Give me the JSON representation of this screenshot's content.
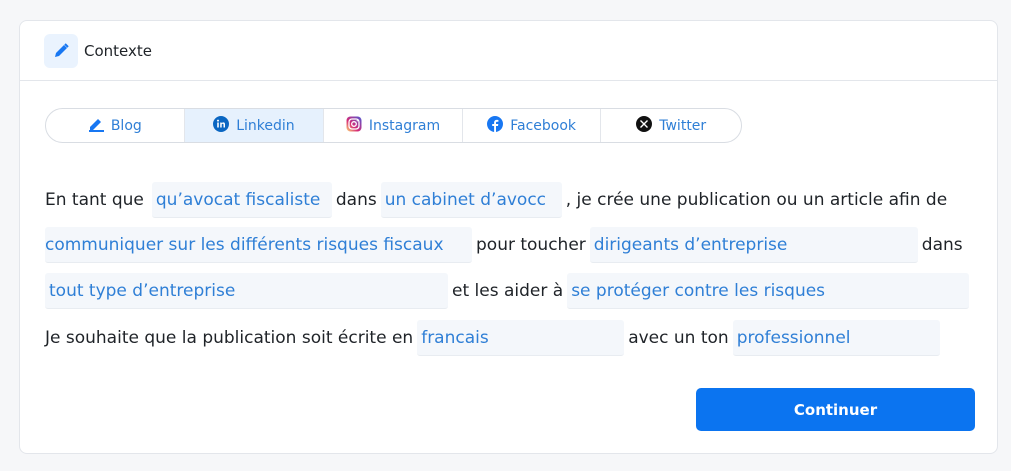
{
  "header": {
    "title": "Contexte",
    "icon": "pen-icon"
  },
  "tabs": [
    {
      "label": "Blog",
      "icon": "pen-line-icon",
      "active": false
    },
    {
      "label": "Linkedin",
      "icon": "linkedin-icon",
      "active": true
    },
    {
      "label": "Instagram",
      "icon": "instagram-icon",
      "active": false
    },
    {
      "label": "Facebook",
      "icon": "facebook-icon",
      "active": false
    },
    {
      "label": "Twitter",
      "icon": "x-twitter-icon",
      "active": false
    }
  ],
  "sentence": {
    "t1": "En tant que",
    "role": "qu’avocat fiscaliste",
    "t2": "dans",
    "company": "un cabinet d’avocc",
    "t3": ", je crée une publication ou un article afin de",
    "goal": "communiquer sur les différents risques fiscaux",
    "t4": "pour toucher",
    "audience": "dirigeants d’entreprise",
    "t5": "dans",
    "sector": "tout type d’entreprise",
    "t6": "et les aider à",
    "benefit": "se protéger contre les risques",
    "t7": "Je souhaite que la publication soit écrite en",
    "language": "francais",
    "t8": "avec un ton",
    "tone": "professionnel"
  },
  "actions": {
    "continue_label": "Continuer"
  },
  "colors": {
    "accent": "#0b74f0",
    "link": "#2f7fd6",
    "active_tab_bg": "#e6f1fd"
  }
}
